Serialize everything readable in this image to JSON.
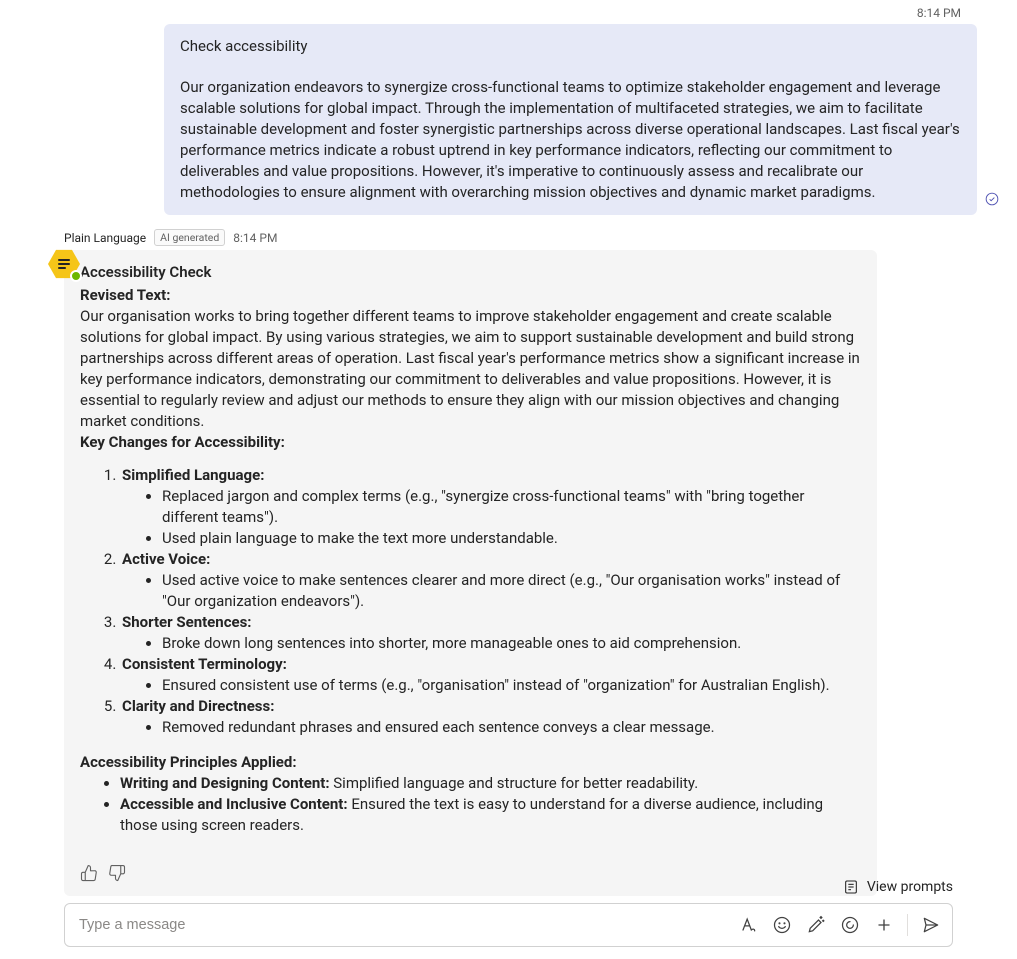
{
  "user_message": {
    "timestamp": "8:14 PM",
    "title": "Check accessibility",
    "body": "Our organization endeavors to synergize cross-functional teams to optimize stakeholder engagement and leverage scalable solutions for global impact. Through the implementation of multifaceted strategies, we aim to facilitate sustainable development and foster synergistic partnerships across diverse operational landscapes.  Last fiscal year's performance metrics indicate a robust uptrend in key performance indicators, reflecting our commitment to deliverables and value propositions. However, it's imperative to continuously assess and recalibrate our methodologies to ensure alignment with overarching mission objectives and dynamic market paradigms."
  },
  "bot_header": {
    "name": "Plain Language",
    "ai_badge": "AI generated",
    "timestamp": "8:14 PM"
  },
  "bot_message": {
    "check_title": "Accessibility Check",
    "revised_label": "Revised Text:",
    "revised_body": "Our organisation works to bring together different teams to improve stakeholder engagement and create scalable solutions for global impact. By using various strategies, we aim to support sustainable development and build strong partnerships across different areas of operation. Last fiscal year's performance metrics show a significant increase in key performance indicators, demonstrating our commitment to deliverables and value propositions. However, it is essential to regularly review and adjust our methods to ensure they align with our mission objectives and changing market conditions.",
    "key_changes_label": "Key Changes for Accessibility:",
    "changes": [
      {
        "title": "Simplified Language:",
        "bullets": [
          "Replaced jargon and complex terms (e.g., \"synergize cross-functional teams\" with \"bring together different teams\").",
          "Used plain language to make the text more understandable."
        ]
      },
      {
        "title": "Active Voice:",
        "bullets": [
          "Used active voice to make sentences clearer and more direct (e.g., \"Our organisation works\" instead of \"Our organization endeavors\")."
        ]
      },
      {
        "title": "Shorter Sentences:",
        "bullets": [
          "Broke down long sentences into shorter, more manageable ones to aid comprehension."
        ]
      },
      {
        "title": "Consistent Terminology:",
        "bullets": [
          "Ensured consistent use of terms (e.g., \"organisation\" instead of \"organization\" for Australian English)."
        ]
      },
      {
        "title": "Clarity and Directness:",
        "bullets": [
          "Removed redundant phrases and ensured each sentence conveys a clear message."
        ]
      }
    ],
    "principles_label": "Accessibility Principles Applied:",
    "principles": [
      {
        "title": "Writing and Designing Content:",
        "text": " Simplified language and structure for better readability."
      },
      {
        "title": "Accessible and Inclusive Content:",
        "text": " Ensured the text is easy to understand for a diverse audience, including those using screen readers."
      }
    ]
  },
  "footer": {
    "view_prompts": "View prompts",
    "placeholder": "Type a message"
  }
}
